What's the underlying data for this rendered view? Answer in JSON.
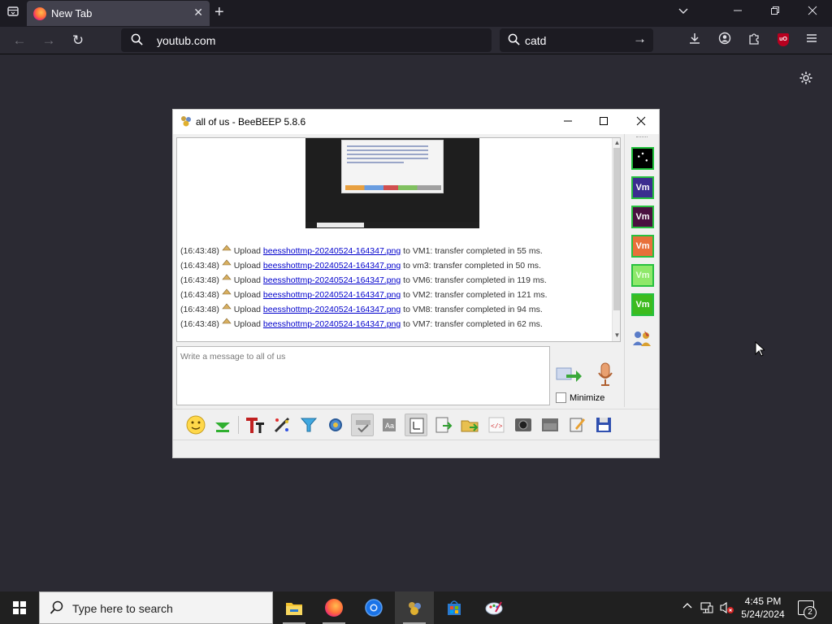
{
  "browser": {
    "tab": {
      "title": "New Tab"
    },
    "address": {
      "value": "youtub.com"
    },
    "search": {
      "value": "catd"
    },
    "icons": {
      "tab_list": "tab-list-icon",
      "new_tab": "plus-icon",
      "back": "back-arrow-icon",
      "forward": "forward-arrow-icon",
      "reload": "reload-icon",
      "downloads": "download-icon",
      "account": "account-icon",
      "extensions": "puzzle-icon",
      "ublock": "ublock-origin-icon",
      "menu": "hamburger-icon",
      "settings": "gear-icon"
    },
    "ublock_badge": "uO"
  },
  "beebeep": {
    "title": "all of us - BeeBEEP 5.8.6",
    "transfers": [
      {
        "time": "(16:43:48)",
        "action": "Upload",
        "file": "beesshottmp-20240524-164347.png",
        "result": "to VM1: transfer completed in 55 ms."
      },
      {
        "time": "(16:43:48)",
        "action": "Upload",
        "file": "beesshottmp-20240524-164347.png",
        "result": "to vm3: transfer completed in 50 ms."
      },
      {
        "time": "(16:43:48)",
        "action": "Upload",
        "file": "beesshottmp-20240524-164347.png",
        "result": "to VM6: transfer completed in 119 ms."
      },
      {
        "time": "(16:43:48)",
        "action": "Upload",
        "file": "beesshottmp-20240524-164347.png",
        "result": "to VM2: transfer completed in 121 ms."
      },
      {
        "time": "(16:43:48)",
        "action": "Upload",
        "file": "beesshottmp-20240524-164347.png",
        "result": "to VM8: transfer completed in 94 ms."
      },
      {
        "time": "(16:43:48)",
        "action": "Upload",
        "file": "beesshottmp-20240524-164347.png",
        "result": "to VM7: transfer completed in 62 ms."
      }
    ],
    "compose_placeholder": "Write a message to all of us",
    "minimize_label": "Minimize",
    "members": [
      {
        "label": "",
        "bg": "#000000",
        "border": "#1fbf3a",
        "fg": "#ffffff"
      },
      {
        "label": "Vm",
        "bg": "#3b2d8f",
        "border": "#28c040",
        "fg": "#ffffff"
      },
      {
        "label": "Vm",
        "bg": "#4a1040",
        "border": "#28c040",
        "fg": "#ffffff"
      },
      {
        "label": "Vm",
        "bg": "#e8703a",
        "border": "#28c040",
        "fg": "#ffffff"
      },
      {
        "label": "Vm",
        "bg": "#8ee86a",
        "border": "#28c040",
        "fg": "#e8ffe0"
      },
      {
        "label": "Vm",
        "bg": "#3dbb1e",
        "border": "#28c040",
        "fg": "#ffffff"
      }
    ],
    "toolbar_icons": [
      "emoji-icon",
      "send-file-icon",
      "font-icon",
      "color-picker-icon",
      "filter-icon",
      "settings-icon",
      "spellcheck-icon",
      "word-complete-icon",
      "keyboard-icon",
      "attach-icon",
      "folder-share-icon",
      "html-icon",
      "screenshot-icon",
      "clear-icon",
      "edit-icon",
      "save-icon"
    ]
  },
  "taskbar": {
    "search_placeholder": "Type here to search",
    "apps": [
      "file-explorer-icon",
      "firefox-icon",
      "chrome-icon",
      "beebeep-icon",
      "store-icon",
      "paint-icon"
    ],
    "time": "4:45 PM",
    "date": "5/24/2024",
    "notification_count": "2"
  }
}
